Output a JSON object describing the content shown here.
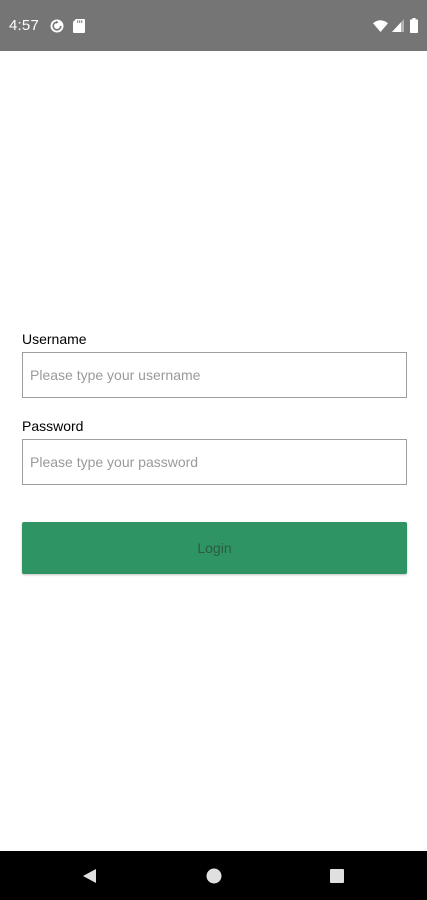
{
  "status_bar": {
    "time": "4:57",
    "background": "#757575",
    "left_icons": [
      "sync-icon",
      "sd-card-icon"
    ],
    "right_icons": [
      "wifi-icon",
      "cell-signal-icon",
      "battery-icon"
    ]
  },
  "form": {
    "username": {
      "label": "Username",
      "placeholder": "Please type your username",
      "value": ""
    },
    "password": {
      "label": "Password",
      "placeholder": "Please type your password",
      "value": ""
    },
    "login_button": {
      "label": "Login",
      "color": "#2e9464"
    }
  },
  "nav_bar": {
    "background": "#000000",
    "buttons": [
      "back-icon",
      "home-icon",
      "recents-icon"
    ]
  }
}
